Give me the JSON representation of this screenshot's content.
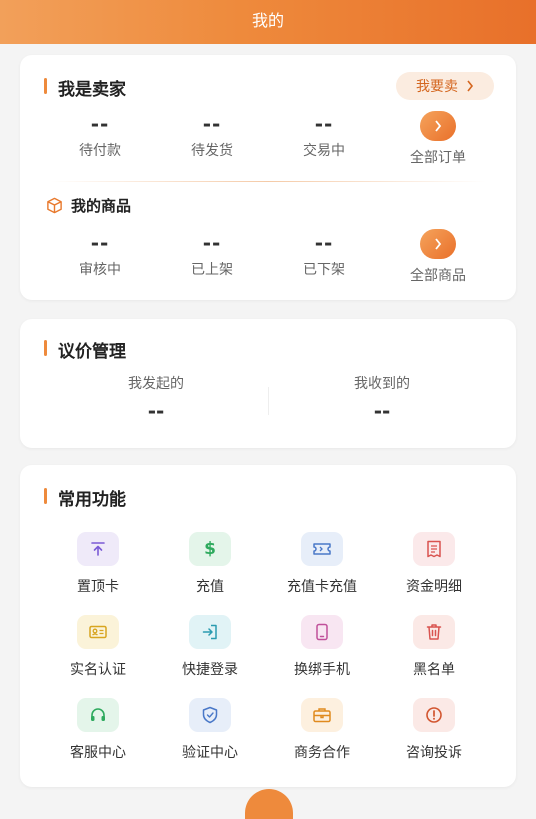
{
  "header": {
    "title": "我的"
  },
  "seller": {
    "title": "我是卖家",
    "sell_button": "我要卖",
    "orders": [
      {
        "value": "--",
        "label": "待付款"
      },
      {
        "value": "--",
        "label": "待发货"
      },
      {
        "value": "--",
        "label": "交易中"
      }
    ],
    "orders_all": "全部订单",
    "goods_title": "我的商品",
    "goods": [
      {
        "value": "--",
        "label": "审核中"
      },
      {
        "value": "--",
        "label": "已上架"
      },
      {
        "value": "--",
        "label": "已下架"
      }
    ],
    "goods_all": "全部商品"
  },
  "bargain": {
    "title": "议价管理",
    "initiated_label": "我发起的",
    "initiated_value": "--",
    "received_label": "我收到的",
    "received_value": "--"
  },
  "functions": {
    "title": "常用功能",
    "items": [
      {
        "label": "置顶卡",
        "icon": "pin-top-icon",
        "color": "#7b5bd6"
      },
      {
        "label": "充值",
        "icon": "dollar-icon",
        "color": "#2eaa5e"
      },
      {
        "label": "充值卡充值",
        "icon": "ticket-icon",
        "color": "#4a78c8"
      },
      {
        "label": "资金明细",
        "icon": "receipt-icon",
        "color": "#d9534f"
      },
      {
        "label": "实名认证",
        "icon": "id-card-icon",
        "color": "#d8a520"
      },
      {
        "label": "快捷登录",
        "icon": "login-icon",
        "color": "#2a9bb0"
      },
      {
        "label": "换绑手机",
        "icon": "phone-icon",
        "color": "#c0509a"
      },
      {
        "label": "黑名单",
        "icon": "trash-icon",
        "color": "#d9534f"
      },
      {
        "label": "客服中心",
        "icon": "headset-icon",
        "color": "#2eaa5e"
      },
      {
        "label": "验证中心",
        "icon": "shield-icon",
        "color": "#4a78c8"
      },
      {
        "label": "商务合作",
        "icon": "briefcase-icon",
        "color": "#e08a1e"
      },
      {
        "label": "咨询投诉",
        "icon": "alert-icon",
        "color": "#d2552f"
      }
    ]
  }
}
